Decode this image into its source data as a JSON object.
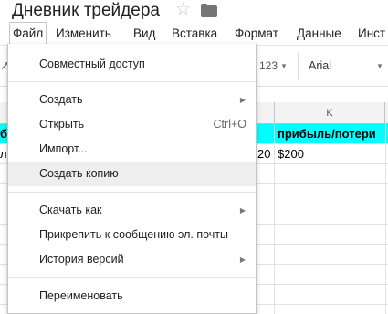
{
  "document": {
    "title": "Дневник трейдера",
    "star_icon": "star-icon",
    "folder_icon": "folder-icon"
  },
  "menubar": {
    "items": [
      "Файл",
      "Изменить",
      "Вид",
      "Вставка",
      "Формат",
      "Данные",
      "Инст"
    ],
    "active": "Файл"
  },
  "toolbar": {
    "number_format": "123",
    "font": "Arial"
  },
  "grid": {
    "column_k": "K",
    "row1": {
      "left_cut": "б",
      "k": "прибыль/потери"
    },
    "row2": {
      "left_cut": "л",
      "j": "20",
      "k": "$200"
    },
    "highlight_color": "#00ffff"
  },
  "file_menu": {
    "items": [
      {
        "label": "Совместный доступ"
      },
      {
        "label": "Создать",
        "submenu": true
      },
      {
        "label": "Открыть",
        "shortcut": "Ctrl+O"
      },
      {
        "label": "Импорт..."
      },
      {
        "label": "Создать копию",
        "hovered": true
      },
      {
        "label": "Скачать как",
        "submenu": true
      },
      {
        "label": "Прикрепить к сообщению эл. почты"
      },
      {
        "label": "История версий",
        "submenu": true
      },
      {
        "label": "Переименовать"
      }
    ]
  }
}
